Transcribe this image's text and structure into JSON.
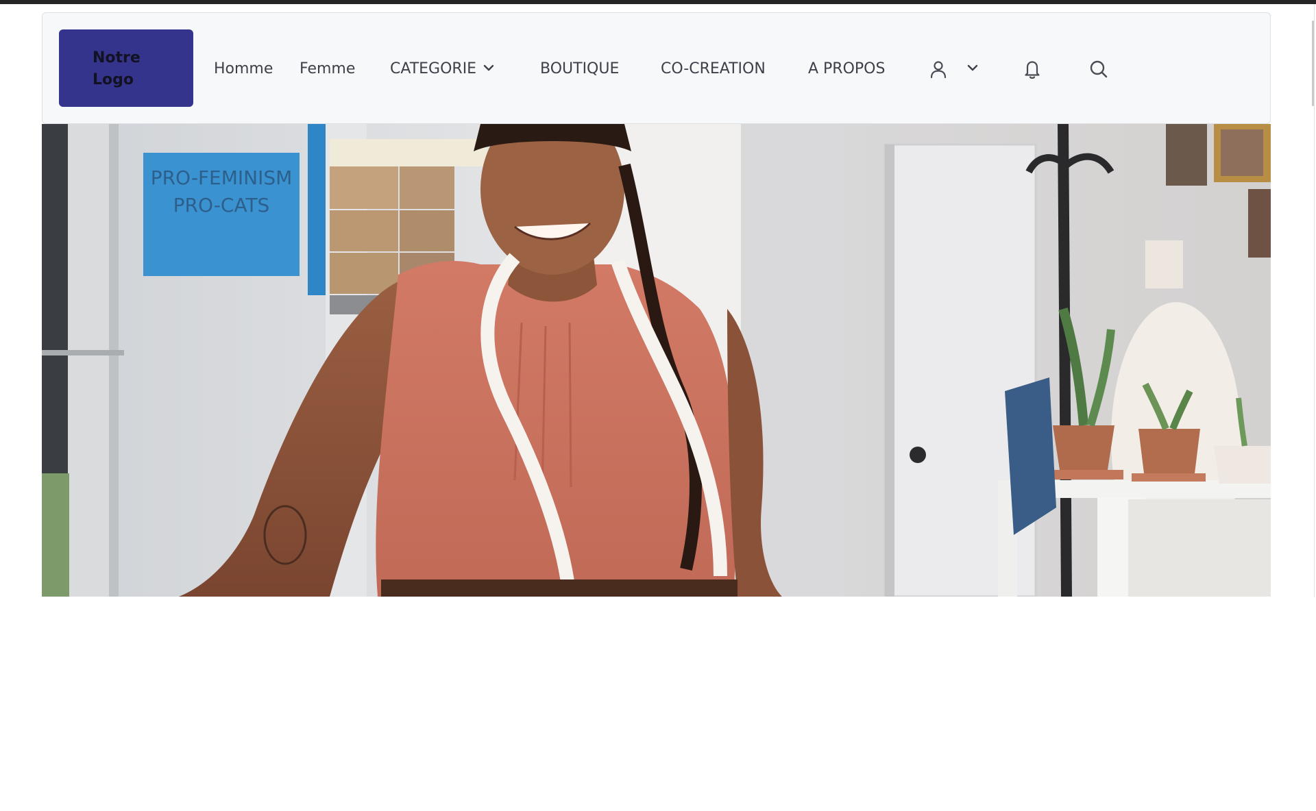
{
  "brand": {
    "logo_line1": "Notre",
    "logo_line2": "Logo",
    "color": "#35348c"
  },
  "nav": {
    "homme": "Homme",
    "femme": "Femme",
    "categorie": "CATEGORIE",
    "boutique": "BOUTIQUE",
    "cocreation": "CO-CREATION",
    "apropos": "A PROPOS"
  },
  "icons": {
    "categorie_chevron": "chevron-down-icon",
    "account": "user-icon",
    "account_chevron": "chevron-down-icon",
    "notifications": "bell-icon",
    "search": "search-icon"
  },
  "hero": {
    "poster_line1": "PRO-FEMINISM",
    "poster_line2": "PRO-CATS"
  },
  "colors": {
    "navbar_bg": "#f7f8fa",
    "nav_text": "#3e3f48",
    "top_strip": "#262626"
  }
}
